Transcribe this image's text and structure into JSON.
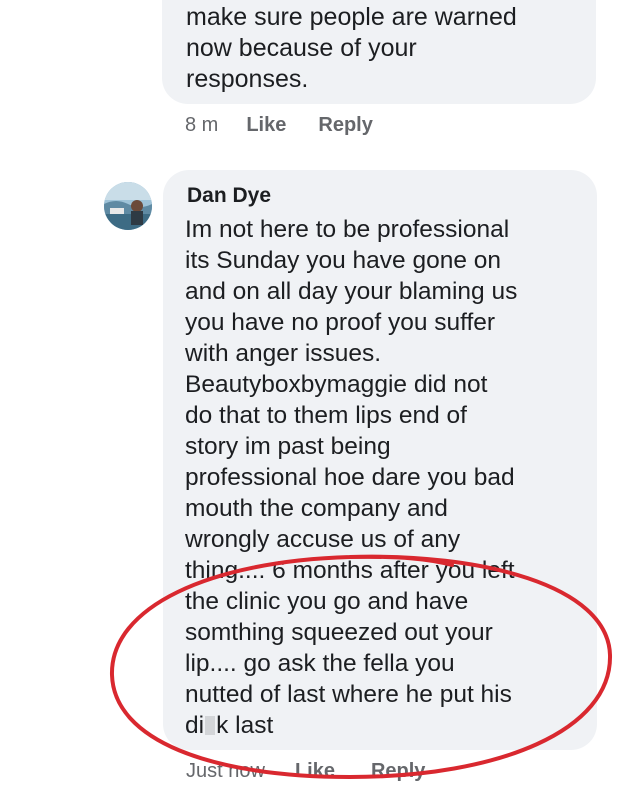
{
  "comments": [
    {
      "lines": [
        "make sure people are warned",
        "now because of your",
        "responses."
      ],
      "time": "8 m",
      "like_label": "Like",
      "reply_label": "Reply"
    },
    {
      "author": "Dan Dye",
      "avatar_icon": "profile-photo",
      "lines": [
        "Im not here to be professional",
        "its Sunday you have gone on",
        "and on all day your blaming us",
        "you have no proof you suffer",
        "with anger issues.",
        "Beautyboxbymaggie did not",
        "do that to them lips end of",
        "story im past being",
        "professional hoe dare you bad",
        "mouth the company and",
        "wrongly accuse us of any",
        "thing.... 6 months after you left",
        "the clinic you go and have",
        "somthing squeezed out your",
        "lip.... go ask the fella you",
        "nutted of last where he put his"
      ],
      "last_line_start": "di",
      "last_line_end": "k last",
      "time": "Just now",
      "like_label": "Like",
      "reply_label": "Reply"
    }
  ],
  "colors": {
    "bubble": "#f0f2f5",
    "text": "#1c1e21",
    "meta": "#65676b",
    "highlight": "#d9282f"
  }
}
